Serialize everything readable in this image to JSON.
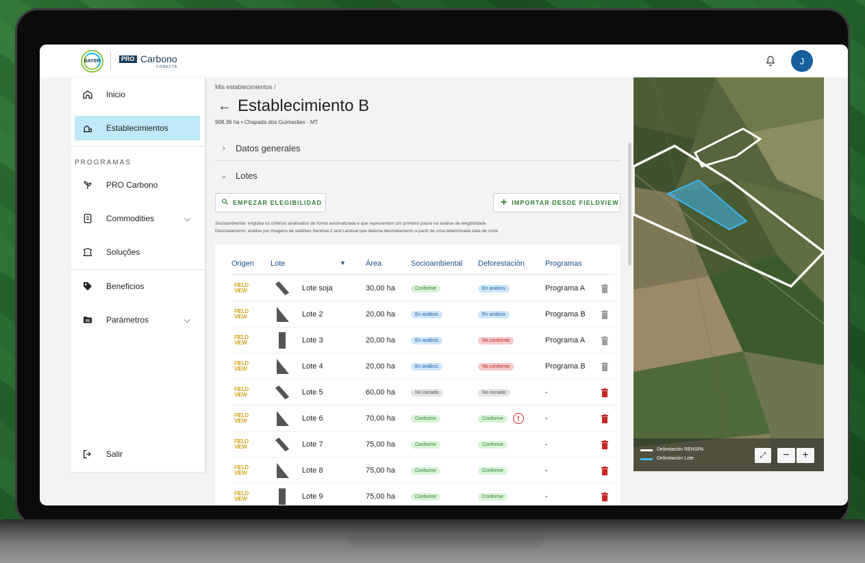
{
  "header": {
    "logo_text": "BAYER",
    "pro_badge": "PRO",
    "app_name": "Carbono",
    "app_sub": "CONECTA",
    "avatar_initial": "J"
  },
  "sidebar": {
    "items": [
      {
        "label": "Inicio",
        "icon": "home-icon"
      },
      {
        "label": "Establecimientos",
        "icon": "farm-icon",
        "active": true
      }
    ],
    "programs_title": "PROGRAMAS",
    "program_items": [
      {
        "label": "PRO Carbono",
        "icon": "sprout-icon"
      },
      {
        "label": "Commodities",
        "icon": "commodities-icon",
        "expandable": true
      },
      {
        "label": "Soluções",
        "icon": "solutions-icon"
      },
      {
        "label": "Beneficios",
        "icon": "tag-icon"
      },
      {
        "label": "Parámetros",
        "icon": "folder-icon",
        "expandable": true
      }
    ],
    "logout": "Salir"
  },
  "main": {
    "breadcrumb": "Mis establecimientos /",
    "title": "Establecimiento B",
    "subtitle": "908,36 ha  • Chapada dos Guimarães - MT",
    "sections": [
      "Datos generales",
      "Lotes"
    ],
    "btn_start": "EMPEZAR ELEGIBILIDAD",
    "btn_import": "IMPORTAR DESDE FIELDVIEW",
    "note_1": "Socioambiental: engloba os critérios analisados de forma automatizada e que representam um primeiro passo na análise de elegibilidade",
    "note_2": "Desmatamento: análise por imagens de satélites Sentinel-2 and Landsat que detecta desmatamento a partir de uma determinada data de corte"
  },
  "table": {
    "headers": [
      "Origen",
      "Lote",
      "Área",
      "Socioambiental",
      "Deforestación",
      "Programas"
    ],
    "origin_logo": "FIELD VIEW",
    "rows": [
      {
        "lote": "Lote soja",
        "area": "30,00 ha",
        "socio": "Conforme",
        "socio_status": "green",
        "defor": "En análisis",
        "defor_status": "blue",
        "programa": "Programa A",
        "shape": "diag",
        "deletable": false,
        "warn": false
      },
      {
        "lote": "Lote 2",
        "area": "20,00 ha",
        "socio": "En análisis",
        "socio_status": "blue",
        "defor": "En análisis",
        "defor_status": "blue",
        "programa": "Programa B",
        "shape": "tri",
        "deletable": false,
        "warn": false
      },
      {
        "lote": "Lote 3",
        "area": "20,00 ha",
        "socio": "En análisis",
        "socio_status": "blue",
        "defor": "No conforme",
        "defor_status": "red",
        "programa": "Programa A",
        "shape": "rect",
        "deletable": false,
        "warn": false
      },
      {
        "lote": "Lote 4",
        "area": "20,00 ha",
        "socio": "En análisis",
        "socio_status": "blue",
        "defor": "No conforme",
        "defor_status": "red",
        "programa": "Programa B",
        "shape": "tri",
        "deletable": false,
        "warn": false
      },
      {
        "lote": "Lote 5",
        "area": "60,00 ha",
        "socio": "No iniciado",
        "socio_status": "gray",
        "defor": "No iniciado",
        "defor_status": "gray",
        "programa": "-",
        "shape": "diag",
        "deletable": true,
        "warn": false
      },
      {
        "lote": "Lote 6",
        "area": "70,00 ha",
        "socio": "Conforme",
        "socio_status": "green",
        "defor": "Conforme",
        "defor_status": "green",
        "programa": "-",
        "shape": "tri",
        "deletable": true,
        "warn": true
      },
      {
        "lote": "Lote 7",
        "area": "75,00 ha",
        "socio": "Conforme",
        "socio_status": "green",
        "defor": "Conforme",
        "defor_status": "green",
        "programa": "-",
        "shape": "diag",
        "deletable": true,
        "warn": false
      },
      {
        "lote": "Lote 8",
        "area": "75,00 ha",
        "socio": "Conforme",
        "socio_status": "green",
        "defor": "Conforme",
        "defor_status": "green",
        "programa": "-",
        "shape": "tri",
        "deletable": true,
        "warn": false
      },
      {
        "lote": "Lote 9",
        "area": "75,00 ha",
        "socio": "Conforme",
        "socio_status": "green",
        "defor": "Conforme",
        "defor_status": "green",
        "programa": "-",
        "shape": "rect",
        "deletable": true,
        "warn": false
      }
    ]
  },
  "map": {
    "legend_renspa": "Delimitación RENSPA",
    "legend_lote": "Delimitación Lote",
    "renspa_color": "#ffffff",
    "lote_color": "#3fb6ef"
  },
  "colors": {
    "accent": "#2e7d32",
    "active_nav": "#bfe8f9",
    "delete_active": "#c62828",
    "delete_disabled": "#9e9e9e"
  }
}
